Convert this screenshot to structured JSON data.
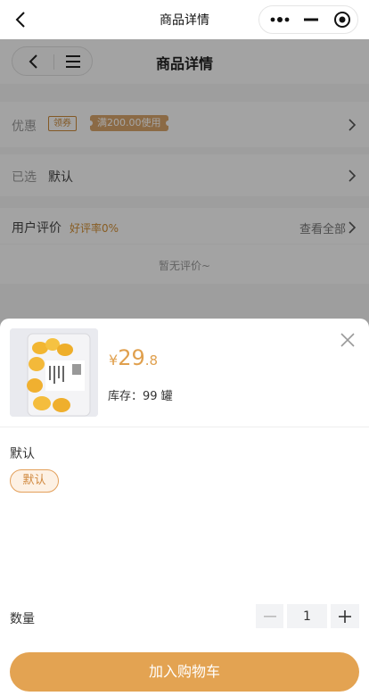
{
  "topbar": {
    "title": "商品详情"
  },
  "page": {
    "title": "商品详情",
    "promo": {
      "label": "优惠",
      "tag": "领券",
      "tip": "满200.00使用"
    },
    "selected": {
      "label": "已选",
      "value": "默认"
    },
    "reviews": {
      "label": "用户评价",
      "rate": "好评率0%",
      "view_all": "查看全部",
      "empty": "暂无评价~"
    }
  },
  "sheet": {
    "price": {
      "currency": "¥",
      "integer": "29",
      "decimal": ".8"
    },
    "stock": "库存：99 罐",
    "spec_title": "默认",
    "spec_option": "默认",
    "quantity_label": "数量",
    "quantity": "1",
    "add_to_cart": "加入购物车"
  },
  "colors": {
    "accent": "#e3a352",
    "price": "#e0a04e",
    "tag": "#c9893a"
  },
  "icons": [
    "back-icon",
    "more-dots-icon",
    "minimize-icon",
    "record-icon",
    "menu-icon",
    "chevron-right-icon",
    "close-icon",
    "minus-icon",
    "plus-icon"
  ]
}
